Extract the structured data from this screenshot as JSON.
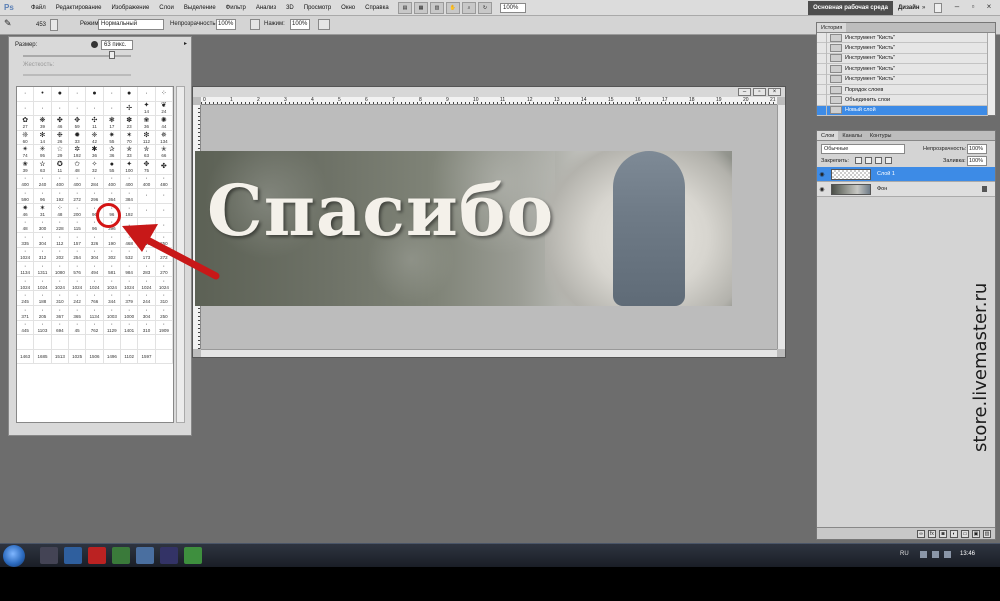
{
  "app": {
    "logo": "Ps",
    "menu": [
      "Файл",
      "Редактирование",
      "Изображение",
      "Слои",
      "Выделение",
      "Фильтр",
      "Анализ",
      "3D",
      "Просмотр",
      "Окно",
      "Справка"
    ],
    "zoom": "100%",
    "workspace_active": "Основная рабочая среда",
    "workspace_design": "Дизайн",
    "workspace_more": "»"
  },
  "options": {
    "brush_size": "453",
    "mode_label": "Режим:",
    "mode_value": "Нормальный",
    "opacity_label": "Непрозрачность:",
    "opacity_value": "100%",
    "flow_label": "Нажим:",
    "flow_value": "100%"
  },
  "brush_panel": {
    "size_label": "Размер:",
    "size_value": "63 пикс.",
    "hardness_label": "Жесткость:",
    "cells": [
      {
        "g": "·",
        "n": ""
      },
      {
        "g": "•",
        "n": ""
      },
      {
        "g": "●",
        "n": ""
      },
      {
        "g": "·",
        "n": ""
      },
      {
        "g": "●",
        "n": ""
      },
      {
        "g": "·",
        "n": ""
      },
      {
        "g": "●",
        "n": ""
      },
      {
        "g": "·",
        "n": ""
      },
      {
        "g": "⁘",
        "n": ""
      },
      {
        "g": "·",
        "n": ""
      },
      {
        "g": "·",
        "n": ""
      },
      {
        "g": "·",
        "n": ""
      },
      {
        "g": "·",
        "n": ""
      },
      {
        "g": "·",
        "n": ""
      },
      {
        "g": "·",
        "n": ""
      },
      {
        "g": "✢",
        "n": ""
      },
      {
        "g": "✦",
        "n": "14"
      },
      {
        "g": "❦",
        "n": "24"
      },
      {
        "g": "✿",
        "n": "27"
      },
      {
        "g": "❋",
        "n": "39"
      },
      {
        "g": "✤",
        "n": "46"
      },
      {
        "g": "✥",
        "n": "59"
      },
      {
        "g": "✣",
        "n": "11"
      },
      {
        "g": "❃",
        "n": "17"
      },
      {
        "g": "✽",
        "n": "23"
      },
      {
        "g": "❀",
        "n": "36"
      },
      {
        "g": "✺",
        "n": "44"
      },
      {
        "g": "❊",
        "n": "60"
      },
      {
        "g": "✻",
        "n": "14"
      },
      {
        "g": "❉",
        "n": "26"
      },
      {
        "g": "✹",
        "n": "33"
      },
      {
        "g": "❈",
        "n": "42"
      },
      {
        "g": "✷",
        "n": "55"
      },
      {
        "g": "✶",
        "n": "70"
      },
      {
        "g": "❇",
        "n": "112"
      },
      {
        "g": "✵",
        "n": "134"
      },
      {
        "g": "✴",
        "n": "74"
      },
      {
        "g": "✳",
        "n": "95"
      },
      {
        "g": "☆",
        "n": "29"
      },
      {
        "g": "✲",
        "n": "192"
      },
      {
        "g": "✱",
        "n": "36"
      },
      {
        "g": "✰",
        "n": "36"
      },
      {
        "g": "✯",
        "n": "33"
      },
      {
        "g": "✮",
        "n": "63"
      },
      {
        "g": "✭",
        "n": "66"
      },
      {
        "g": "✬",
        "n": "39"
      },
      {
        "g": "✫",
        "n": "63"
      },
      {
        "g": "✪",
        "n": "11"
      },
      {
        "g": "✩",
        "n": "48"
      },
      {
        "g": "✧",
        "n": "32"
      },
      {
        "g": "●",
        "n": "55"
      },
      {
        "g": "✦",
        "n": "100"
      },
      {
        "g": "✥",
        "n": "75"
      },
      {
        "g": "✤",
        "n": ""
      },
      {
        "g": "·",
        "n": "400"
      },
      {
        "g": "·",
        "n": "240"
      },
      {
        "g": "·",
        "n": "400"
      },
      {
        "g": "·",
        "n": "400"
      },
      {
        "g": "·",
        "n": "284"
      },
      {
        "g": "·",
        "n": "400"
      },
      {
        "g": "·",
        "n": "400"
      },
      {
        "g": "·",
        "n": "400"
      },
      {
        "g": "·",
        "n": "480"
      },
      {
        "g": "·",
        "n": "590"
      },
      {
        "g": "·",
        "n": "96"
      },
      {
        "g": "·",
        "n": "192"
      },
      {
        "g": "·",
        "n": "272"
      },
      {
        "g": "·",
        "n": "296"
      },
      {
        "g": "·",
        "n": "364"
      },
      {
        "g": "·",
        "n": "384"
      },
      {
        "g": "·",
        "n": ""
      },
      {
        "g": "·",
        "n": ""
      },
      {
        "g": "✷",
        "n": "46"
      },
      {
        "g": "✶",
        "n": "31"
      },
      {
        "g": "⁘",
        "n": "48"
      },
      {
        "g": "·",
        "n": "200"
      },
      {
        "g": "·",
        "n": "96"
      },
      {
        "g": "·",
        "n": "96"
      },
      {
        "g": "·",
        "n": "192"
      },
      {
        "g": "·",
        "n": ""
      },
      {
        "g": "·",
        "n": ""
      },
      {
        "g": "·",
        "n": "48"
      },
      {
        "g": "·",
        "n": "300"
      },
      {
        "g": "·",
        "n": "228"
      },
      {
        "g": "·",
        "n": "115"
      },
      {
        "g": "·",
        "n": "96"
      },
      {
        "g": "·",
        "n": "396"
      },
      {
        "g": "·",
        "n": ""
      },
      {
        "g": "·",
        "n": ""
      },
      {
        "g": "·",
        "n": ""
      },
      {
        "g": "·",
        "n": "335"
      },
      {
        "g": "·",
        "n": "304"
      },
      {
        "g": "·",
        "n": "112"
      },
      {
        "g": "·",
        "n": "157"
      },
      {
        "g": "·",
        "n": "326"
      },
      {
        "g": "·",
        "n": "190"
      },
      {
        "g": "·",
        "n": "468"
      },
      {
        "g": "·",
        "n": "310"
      },
      {
        "g": "·",
        "n": "250"
      },
      {
        "g": "·",
        "n": "1024"
      },
      {
        "g": "·",
        "n": "312"
      },
      {
        "g": "·",
        "n": "202"
      },
      {
        "g": "·",
        "n": "254"
      },
      {
        "g": "·",
        "n": "304"
      },
      {
        "g": "·",
        "n": "302"
      },
      {
        "g": "·",
        "n": "532"
      },
      {
        "g": "·",
        "n": "173"
      },
      {
        "g": "·",
        "n": "272"
      },
      {
        "g": "·",
        "n": "1134"
      },
      {
        "g": "·",
        "n": "1311"
      },
      {
        "g": "·",
        "n": "1080"
      },
      {
        "g": "·",
        "n": "576"
      },
      {
        "g": "·",
        "n": "494"
      },
      {
        "g": "·",
        "n": "581"
      },
      {
        "g": "·",
        "n": "984"
      },
      {
        "g": "·",
        "n": "283"
      },
      {
        "g": "·",
        "n": "270"
      },
      {
        "g": "·",
        "n": "1024"
      },
      {
        "g": "·",
        "n": "1024"
      },
      {
        "g": "·",
        "n": "1024"
      },
      {
        "g": "·",
        "n": "1024"
      },
      {
        "g": "·",
        "n": "1024"
      },
      {
        "g": "·",
        "n": "1024"
      },
      {
        "g": "·",
        "n": "1024"
      },
      {
        "g": "·",
        "n": "1024"
      },
      {
        "g": "·",
        "n": "1024"
      },
      {
        "g": "·",
        "n": "245"
      },
      {
        "g": "·",
        "n": "188"
      },
      {
        "g": "·",
        "n": "310"
      },
      {
        "g": "·",
        "n": "242"
      },
      {
        "g": "·",
        "n": "766"
      },
      {
        "g": "·",
        "n": "344"
      },
      {
        "g": "·",
        "n": "379"
      },
      {
        "g": "·",
        "n": "244"
      },
      {
        "g": "·",
        "n": "310"
      },
      {
        "g": "·",
        "n": "371"
      },
      {
        "g": "·",
        "n": "205"
      },
      {
        "g": "·",
        "n": "367"
      },
      {
        "g": "·",
        "n": "365"
      },
      {
        "g": "·",
        "n": "1134"
      },
      {
        "g": "·",
        "n": "1003"
      },
      {
        "g": "·",
        "n": "1000"
      },
      {
        "g": "·",
        "n": "304"
      },
      {
        "g": "·",
        "n": "250"
      },
      {
        "g": "·",
        "n": "445"
      },
      {
        "g": "·",
        "n": "1103"
      },
      {
        "g": "·",
        "n": "694"
      },
      {
        "g": "·",
        "n": "45"
      },
      {
        "g": "·",
        "n": "762"
      },
      {
        "g": "·",
        "n": "1129"
      },
      {
        "g": "·",
        "n": "1401"
      },
      {
        "g": "·",
        "n": "310"
      },
      {
        "g": "·",
        "n": "1909"
      },
      {
        "g": "",
        "n": ""
      },
      {
        "g": "",
        "n": ""
      },
      {
        "g": "",
        "n": ""
      },
      {
        "g": "",
        "n": ""
      },
      {
        "g": "",
        "n": ""
      },
      {
        "g": "",
        "n": ""
      },
      {
        "g": "",
        "n": ""
      },
      {
        "g": "",
        "n": ""
      },
      {
        "g": "",
        "n": ""
      },
      {
        "g": "",
        "n": "1463"
      },
      {
        "g": "",
        "n": "1685"
      },
      {
        "g": "",
        "n": "1513"
      },
      {
        "g": "",
        "n": "1025"
      },
      {
        "g": "",
        "n": "1506"
      },
      {
        "g": "",
        "n": "1496"
      },
      {
        "g": "",
        "n": "1102"
      },
      {
        "g": "",
        "n": "1597"
      },
      {
        "g": "",
        "n": ""
      }
    ]
  },
  "document": {
    "ruler_numbers": [
      "0",
      "1",
      "2",
      "3",
      "4",
      "5",
      "6",
      "7",
      "8",
      "9",
      "10",
      "11",
      "12",
      "13",
      "14",
      "15",
      "16",
      "17",
      "18",
      "19",
      "20",
      "21"
    ],
    "banner_text": "Спасибо"
  },
  "history": {
    "tabs": [
      "История"
    ],
    "items": [
      {
        "label": "Инструмент \"Кисть\"",
        "selected": false
      },
      {
        "label": "Инструмент \"Кисть\"",
        "selected": false
      },
      {
        "label": "Инструмент \"Кисть\"",
        "selected": false
      },
      {
        "label": "Инструмент \"Кисть\"",
        "selected": false
      },
      {
        "label": "Инструмент \"Кисть\"",
        "selected": false
      },
      {
        "label": "Порядок слоев",
        "selected": false
      },
      {
        "label": "Объединить слои",
        "selected": false
      },
      {
        "label": "Новый слой",
        "selected": true
      }
    ]
  },
  "layers": {
    "tabs": [
      "Слои",
      "Каналы",
      "Контуры"
    ],
    "blend_mode": "Обычные",
    "opacity_label": "Непрозрачность:",
    "opacity_value": "100%",
    "lock_label": "Закрепить:",
    "fill_label": "Заливка:",
    "fill_value": "100%",
    "items": [
      {
        "name": "Слой 1",
        "selected": true
      },
      {
        "name": "Фон",
        "selected": false
      }
    ]
  },
  "taskbar": {
    "lang": "RU",
    "clock": "13:46"
  },
  "watermark": "store.livemaster.ru"
}
